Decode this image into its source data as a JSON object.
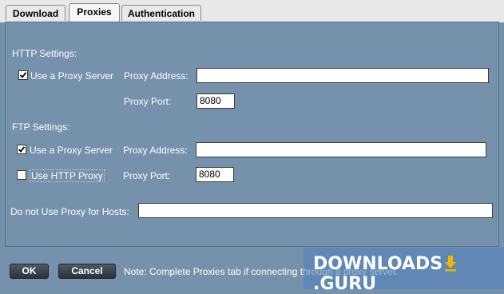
{
  "tabs": [
    {
      "label": "Download",
      "active": false
    },
    {
      "label": "Proxies",
      "active": true
    },
    {
      "label": "Authentication",
      "active": false
    }
  ],
  "http": {
    "section_label": "HTTP Settings:",
    "use_proxy_label": "Use a Proxy Server",
    "use_proxy_checked": true,
    "address_label": "Proxy Address:",
    "address_value": "",
    "port_label": "Proxy Port:",
    "port_value": "8080"
  },
  "ftp": {
    "section_label": "FTP Settings:",
    "use_proxy_label": "Use a Proxy Server",
    "use_proxy_checked": true,
    "use_http_label": "Use HTTP Proxy",
    "use_http_checked": false,
    "address_label": "Proxy Address:",
    "address_value": "",
    "port_label": "Proxy Port:",
    "port_value": "8080"
  },
  "no_proxy": {
    "label": "Do not Use Proxy for Hosts:",
    "value": ""
  },
  "footer": {
    "ok_label": "OK",
    "cancel_label": "Cancel",
    "note": "Note: Complete Proxies tab if connecting through a proxy server."
  },
  "watermark": {
    "text_left": "DOWNLOADS",
    "text_right": ".GURU"
  },
  "colors": {
    "background": "#7591ac",
    "tabstrip": "#e8e8e8",
    "watermark_arrow": "#f5b400"
  }
}
